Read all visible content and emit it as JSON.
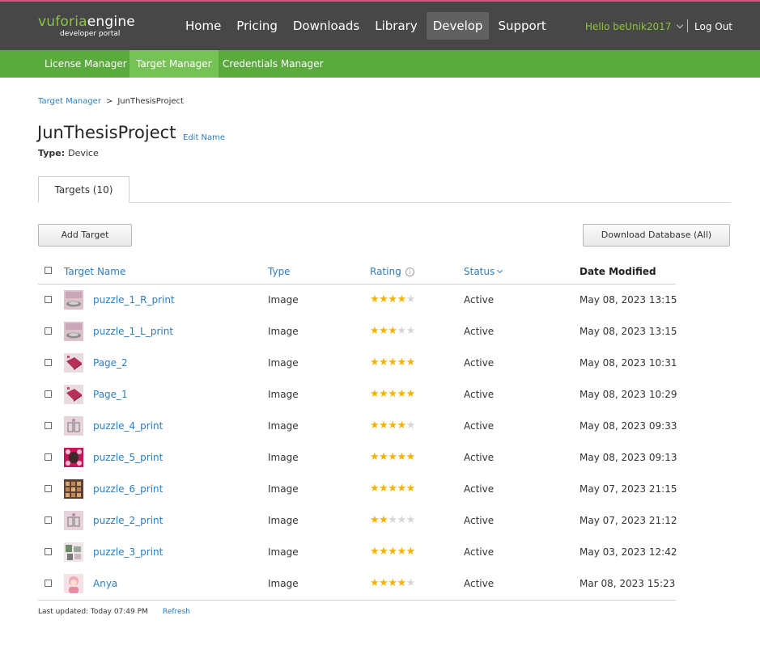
{
  "header": {
    "logo_brand": "vuforia",
    "logo_product": "engine",
    "logo_sub": "developer portal",
    "nav": [
      {
        "label": "Home"
      },
      {
        "label": "Pricing"
      },
      {
        "label": "Downloads"
      },
      {
        "label": "Library"
      },
      {
        "label": "Develop",
        "active": true
      },
      {
        "label": "Support"
      }
    ],
    "greeting": "Hello beUnik2017",
    "logout": "Log Out"
  },
  "subnav": [
    {
      "label": "License Manager"
    },
    {
      "label": "Target Manager",
      "active": true
    },
    {
      "label": "Credentials Manager"
    }
  ],
  "breadcrumb": {
    "parent": "Target Manager",
    "separator": ">",
    "current": "JunThesisProject"
  },
  "project": {
    "title": "JunThesisProject",
    "edit_name": "Edit Name",
    "type_label": "Type:",
    "type_value": "Device"
  },
  "tabs": [
    {
      "label": "Targets (10)"
    }
  ],
  "buttons": {
    "add_target": "Add Target",
    "download_db": "Download Database (All)"
  },
  "table": {
    "columns": {
      "name": "Target Name",
      "type": "Type",
      "rating": "Rating",
      "status": "Status",
      "date": "Date Modified"
    },
    "rows": [
      {
        "name": "puzzle_1_R_print",
        "type": "Image",
        "rating": 4,
        "status": "Active",
        "date": "May 08, 2023 13:15",
        "thumb": "puzzle"
      },
      {
        "name": "puzzle_1_L_print",
        "type": "Image",
        "rating": 3,
        "status": "Active",
        "date": "May 08, 2023 13:15",
        "thumb": "puzzle"
      },
      {
        "name": "Page_2",
        "type": "Image",
        "rating": 5,
        "status": "Active",
        "date": "May 08, 2023 10:31",
        "thumb": "book"
      },
      {
        "name": "Page_1",
        "type": "Image",
        "rating": 5,
        "status": "Active",
        "date": "May 08, 2023 10:29",
        "thumb": "book"
      },
      {
        "name": "puzzle_4_print",
        "type": "Image",
        "rating": 4,
        "status": "Active",
        "date": "May 08, 2023 09:33",
        "thumb": "frame"
      },
      {
        "name": "puzzle_5_print",
        "type": "Image",
        "rating": 5,
        "status": "Active",
        "date": "May 08, 2023 09:13",
        "thumb": "pattern"
      },
      {
        "name": "puzzle_6_print",
        "type": "Image",
        "rating": 5,
        "status": "Active",
        "date": "May 07, 2023 21:15",
        "thumb": "grid"
      },
      {
        "name": "puzzle_2_print",
        "type": "Image",
        "rating": 2,
        "status": "Active",
        "date": "May 07, 2023 21:12",
        "thumb": "frame"
      },
      {
        "name": "puzzle_3_print",
        "type": "Image",
        "rating": 5,
        "status": "Active",
        "date": "May 03, 2023 12:42",
        "thumb": "collage"
      },
      {
        "name": "Anya",
        "type": "Image",
        "rating": 4,
        "status": "Active",
        "date": "Mar 08, 2023 15:23",
        "thumb": "portrait"
      }
    ]
  },
  "footer": {
    "last_updated": "Last updated: Today 07:49 PM",
    "refresh": "Refresh"
  },
  "colors": {
    "topbar": "#474747",
    "subnav": "#5aaa3d",
    "subnav_active": "#76c257",
    "link": "#2a7ec0",
    "star": "#f5b301",
    "brand_green": "#8cc63e"
  }
}
